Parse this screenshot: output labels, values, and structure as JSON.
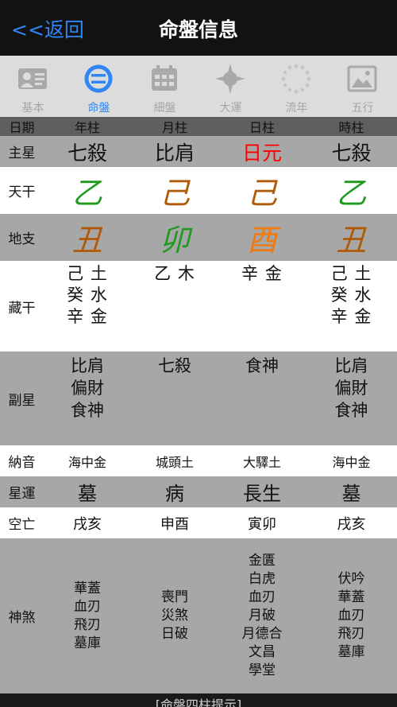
{
  "navbar": {
    "back_label": "<<返回",
    "title": "命盤信息"
  },
  "tabs": [
    {
      "label": "基本",
      "icon": "profile-card-icon",
      "active": false
    },
    {
      "label": "命盤",
      "icon": "chart-circle-icon",
      "active": true
    },
    {
      "label": "細盤",
      "icon": "calendar-grid-icon",
      "active": false
    },
    {
      "label": "大運",
      "icon": "compass-icon",
      "active": false
    },
    {
      "label": "流年",
      "icon": "sun-dots-icon",
      "active": false
    },
    {
      "label": "五行",
      "icon": "picture-icon",
      "active": false
    }
  ],
  "header": {
    "label": "日期",
    "columns": [
      "年柱",
      "月柱",
      "日柱",
      "時柱"
    ]
  },
  "main_star": {
    "label": "主星",
    "values": [
      "七殺",
      "比肩",
      "日元",
      "七殺"
    ],
    "highlight_color": "#ff0000"
  },
  "heavenly_stems": {
    "label": "天干",
    "values": [
      "乙",
      "己",
      "己",
      "乙"
    ],
    "colors": [
      "#1f9a1f",
      "#b05a08",
      "#b05a08",
      "#1f9a1f"
    ]
  },
  "earthly_branches": {
    "label": "地支",
    "values": [
      "丑",
      "卯",
      "酉",
      "丑"
    ],
    "colors": [
      "#b05a08",
      "#1f9a1f",
      "#ee7a10",
      "#b05a08"
    ]
  },
  "hidden_stems": {
    "label": "藏干",
    "values": [
      [
        "己 土",
        "癸 水",
        "辛 金"
      ],
      [
        "乙 木"
      ],
      [
        "辛 金"
      ],
      [
        "己 土",
        "癸 水",
        "辛 金"
      ]
    ]
  },
  "secondary_stars": {
    "label": "副星",
    "values": [
      [
        "比肩",
        "偏財",
        "食神"
      ],
      [
        "七殺"
      ],
      [
        "食神"
      ],
      [
        "比肩",
        "偏財",
        "食神"
      ]
    ]
  },
  "nayin": {
    "label": "納音",
    "values": [
      "海中金",
      "城頭土",
      "大驛土",
      "海中金"
    ]
  },
  "star_phase": {
    "label": "星運",
    "values": [
      "墓",
      "病",
      "長生",
      "墓"
    ]
  },
  "void": {
    "label": "空亡",
    "values": [
      "戌亥",
      "申酉",
      "寅卯",
      "戌亥"
    ]
  },
  "shensha": {
    "label": "神煞",
    "values": [
      [
        "華蓋",
        "血刃",
        "飛刃",
        "墓庫"
      ],
      [
        "喪門",
        "災煞",
        "日破"
      ],
      [
        "金匱",
        "白虎",
        "血刃",
        "月破",
        "月德合",
        "文昌",
        "學堂"
      ],
      [
        "伏吟",
        "華蓋",
        "血刃",
        "飛刃",
        "墓庫"
      ]
    ]
  },
  "footer": {
    "link_label": "[命盤四柱提示]"
  }
}
